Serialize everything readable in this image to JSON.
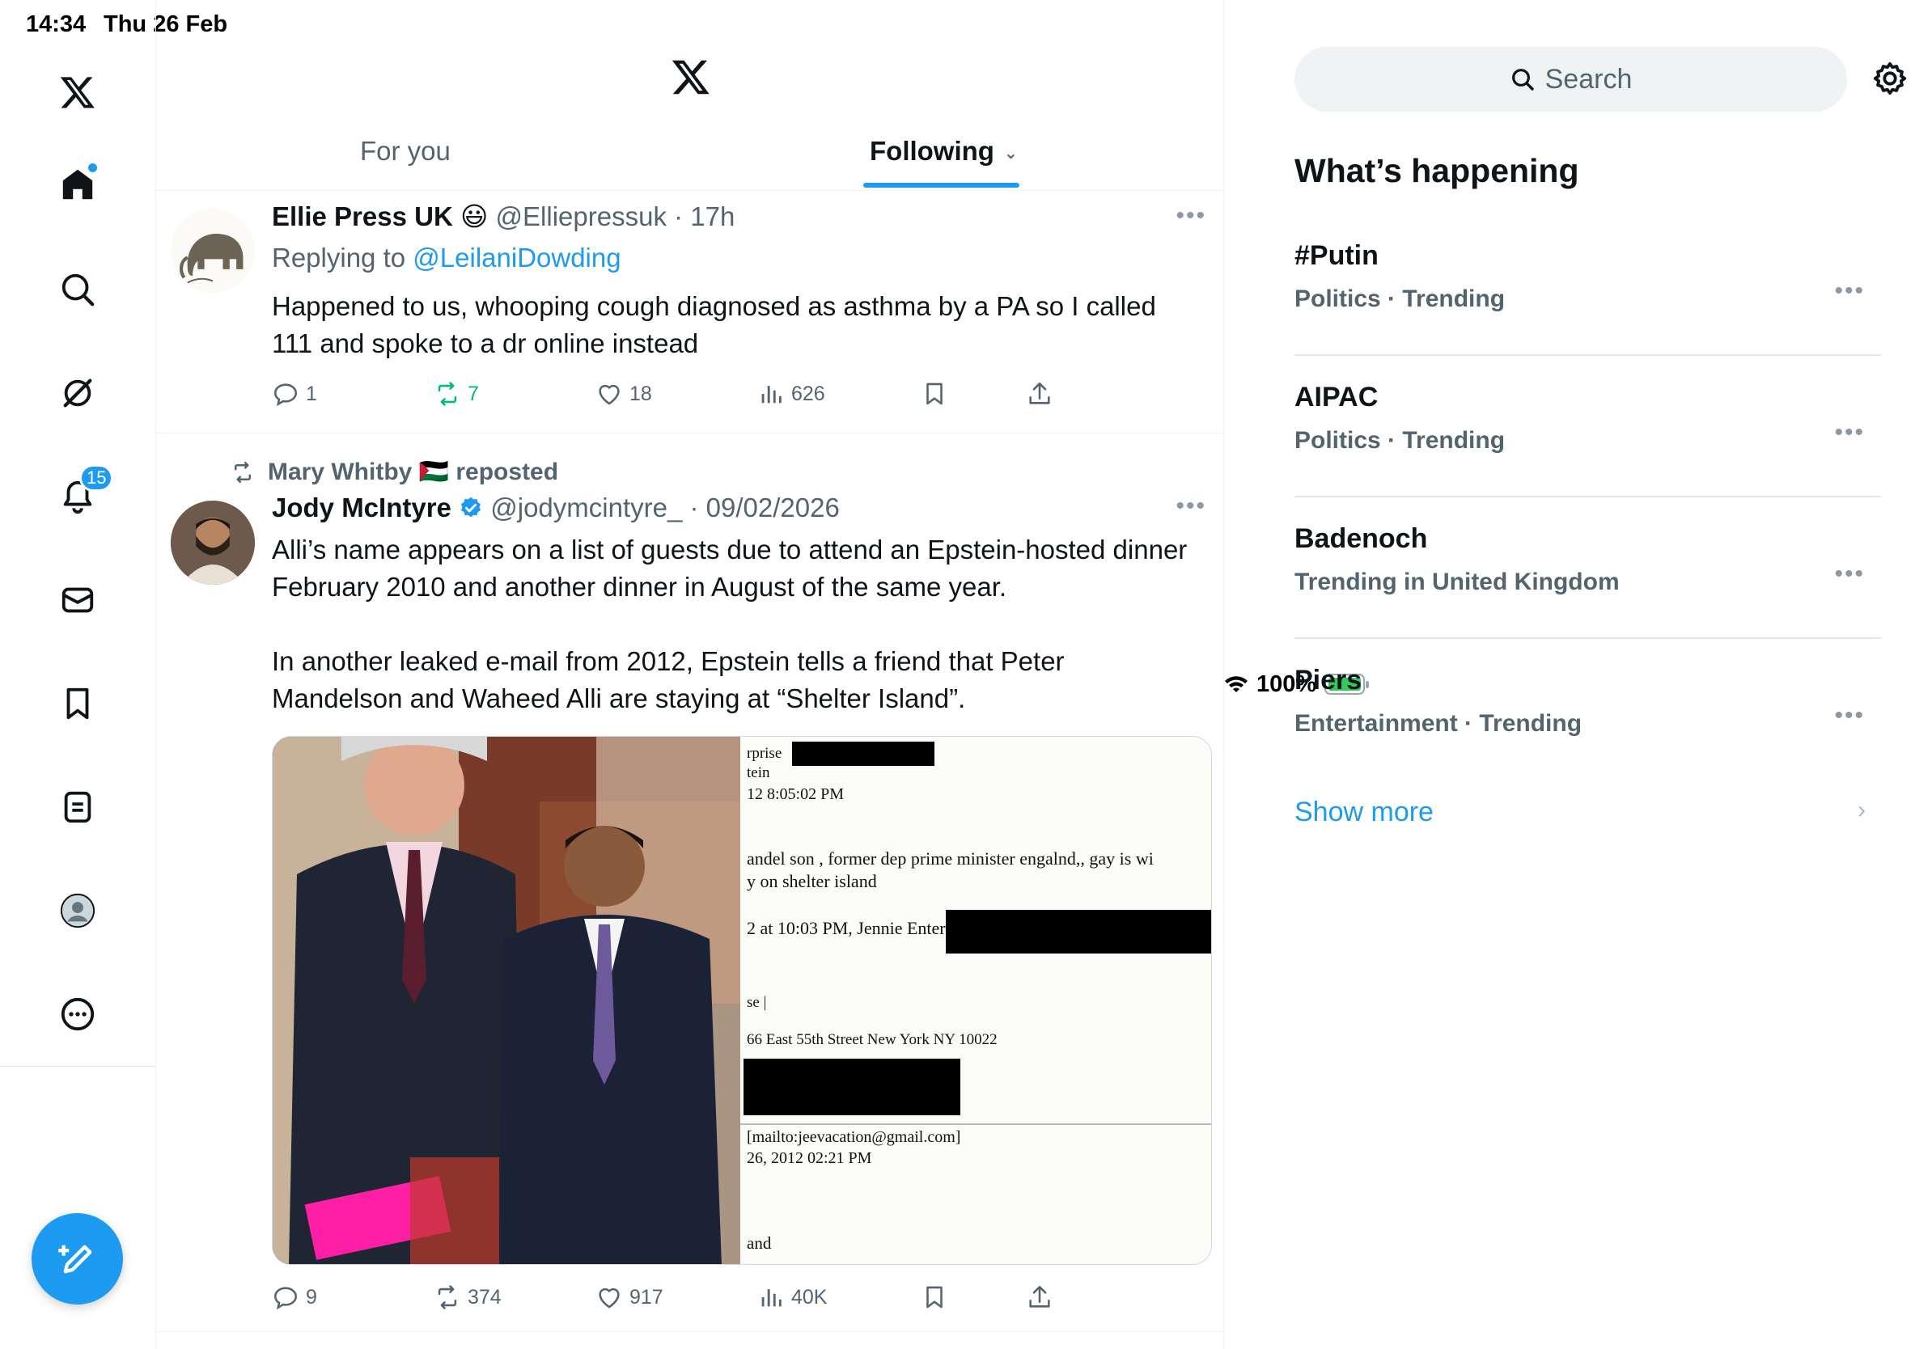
{
  "status_bar": {
    "time": "14:34",
    "date": "Thu 26 Feb",
    "battery": "100%"
  },
  "nav": {
    "notifications_badge": "15"
  },
  "header": {
    "tabs": [
      {
        "label": "For you"
      },
      {
        "label": "Following"
      }
    ]
  },
  "tweets": [
    {
      "name": "Ellie Press UK",
      "emoji": "😃",
      "handle": "@Elliepressuk",
      "time": "17h",
      "replying_prefix": "Replying to",
      "replying_to": "@LeilaniDowding",
      "text": "Happened to us, whooping cough diagnosed as asthma by a PA so I called 111 and spoke to a dr online instead",
      "replies": "1",
      "reposts": "7",
      "likes": "18",
      "views": "626"
    },
    {
      "reposted_by": "Mary Whitby 🇵🇸 reposted",
      "name": "Jody McIntyre",
      "handle": "@jodymcintyre_",
      "time": "09/02/2026",
      "text1": "Alli’s name appears on a list of guests due to attend an Epstein-hosted dinner February 2010 and another dinner in August of the same year.",
      "text2": "In another leaked e-mail from 2012, Epstein tells a friend that Peter Mandelson and Waheed Alli are staying at “Shelter Island”.",
      "replies": "9",
      "reposts": "374",
      "likes": "917",
      "views": "40K",
      "doc_lines": [
        "rprise",
        "tein",
        "12 8:05:02 PM",
        "andel son   , former dep prime minister engalnd,, gay is wi",
        "y on shelter island",
        "2 at 10:03 PM, Jennie Enterprise <",
        "se |",
        "66 East 55th Street New York NY 10022",
        "[mailto:jeevacation@gmail.com]",
        "26, 2012 02:21 PM",
        "and"
      ]
    }
  ],
  "sidebar": {
    "search_placeholder": "Search",
    "title": "What’s happening",
    "trends": [
      {
        "name": "#Putin",
        "meta": "Politics · Trending"
      },
      {
        "name": "AIPAC",
        "meta": "Politics · Trending"
      },
      {
        "name": "Badenoch",
        "meta": "Trending in United Kingdom"
      },
      {
        "name": "Piers",
        "meta": "Entertainment · Trending"
      }
    ],
    "show_more": "Show more"
  },
  "colors": {
    "accent": "#1d9bf0",
    "repost_green": "#00ba7c",
    "muted": "#536471"
  }
}
